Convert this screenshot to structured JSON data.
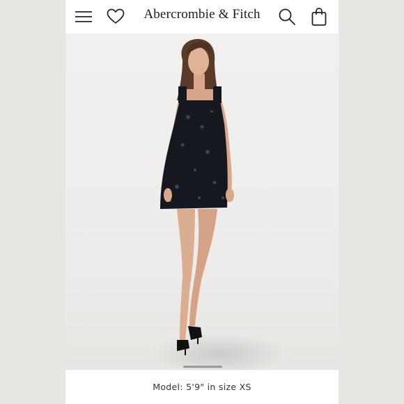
{
  "header": {
    "brand": "Abercrombie & Fitch",
    "menu_icon": "hamburger-menu-icon",
    "wishlist_icon": "heart-icon",
    "search_icon": "search-icon",
    "bag_icon": "shopping-bag-icon"
  },
  "product": {
    "image_alt_icon": "product-photo",
    "caption": "Model: 5'9\" in size XS"
  },
  "colors": {
    "background": "#e9e7e4",
    "dress": "#16181f",
    "text": "#1a1a1a"
  }
}
